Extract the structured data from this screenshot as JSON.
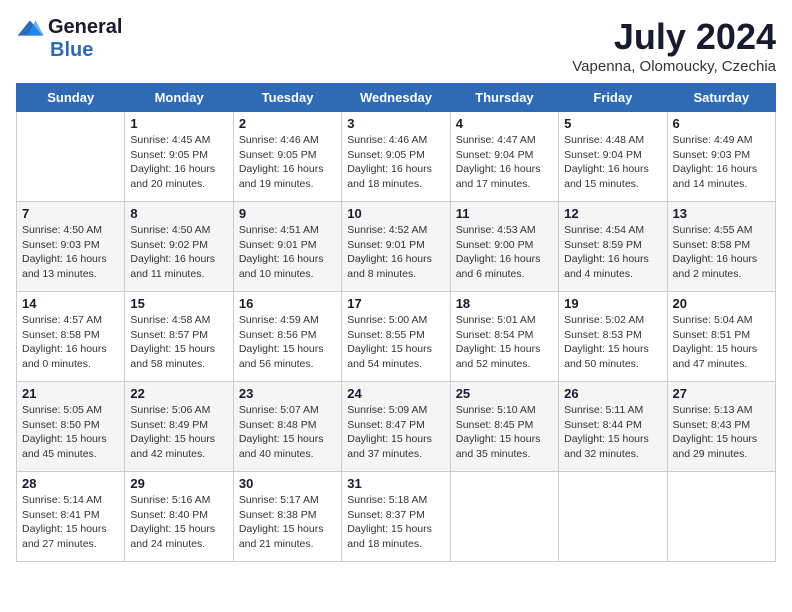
{
  "logo": {
    "general": "General",
    "blue": "Blue"
  },
  "title": "July 2024",
  "location": "Vapenna, Olomoucky, Czechia",
  "header": {
    "days": [
      "Sunday",
      "Monday",
      "Tuesday",
      "Wednesday",
      "Thursday",
      "Friday",
      "Saturday"
    ]
  },
  "weeks": [
    [
      {
        "day": "",
        "content": ""
      },
      {
        "day": "1",
        "content": "Sunrise: 4:45 AM\nSunset: 9:05 PM\nDaylight: 16 hours\nand 20 minutes."
      },
      {
        "day": "2",
        "content": "Sunrise: 4:46 AM\nSunset: 9:05 PM\nDaylight: 16 hours\nand 19 minutes."
      },
      {
        "day": "3",
        "content": "Sunrise: 4:46 AM\nSunset: 9:05 PM\nDaylight: 16 hours\nand 18 minutes."
      },
      {
        "day": "4",
        "content": "Sunrise: 4:47 AM\nSunset: 9:04 PM\nDaylight: 16 hours\nand 17 minutes."
      },
      {
        "day": "5",
        "content": "Sunrise: 4:48 AM\nSunset: 9:04 PM\nDaylight: 16 hours\nand 15 minutes."
      },
      {
        "day": "6",
        "content": "Sunrise: 4:49 AM\nSunset: 9:03 PM\nDaylight: 16 hours\nand 14 minutes."
      }
    ],
    [
      {
        "day": "7",
        "content": "Sunrise: 4:50 AM\nSunset: 9:03 PM\nDaylight: 16 hours\nand 13 minutes."
      },
      {
        "day": "8",
        "content": "Sunrise: 4:50 AM\nSunset: 9:02 PM\nDaylight: 16 hours\nand 11 minutes."
      },
      {
        "day": "9",
        "content": "Sunrise: 4:51 AM\nSunset: 9:01 PM\nDaylight: 16 hours\nand 10 minutes."
      },
      {
        "day": "10",
        "content": "Sunrise: 4:52 AM\nSunset: 9:01 PM\nDaylight: 16 hours\nand 8 minutes."
      },
      {
        "day": "11",
        "content": "Sunrise: 4:53 AM\nSunset: 9:00 PM\nDaylight: 16 hours\nand 6 minutes."
      },
      {
        "day": "12",
        "content": "Sunrise: 4:54 AM\nSunset: 8:59 PM\nDaylight: 16 hours\nand 4 minutes."
      },
      {
        "day": "13",
        "content": "Sunrise: 4:55 AM\nSunset: 8:58 PM\nDaylight: 16 hours\nand 2 minutes."
      }
    ],
    [
      {
        "day": "14",
        "content": "Sunrise: 4:57 AM\nSunset: 8:58 PM\nDaylight: 16 hours\nand 0 minutes."
      },
      {
        "day": "15",
        "content": "Sunrise: 4:58 AM\nSunset: 8:57 PM\nDaylight: 15 hours\nand 58 minutes."
      },
      {
        "day": "16",
        "content": "Sunrise: 4:59 AM\nSunset: 8:56 PM\nDaylight: 15 hours\nand 56 minutes."
      },
      {
        "day": "17",
        "content": "Sunrise: 5:00 AM\nSunset: 8:55 PM\nDaylight: 15 hours\nand 54 minutes."
      },
      {
        "day": "18",
        "content": "Sunrise: 5:01 AM\nSunset: 8:54 PM\nDaylight: 15 hours\nand 52 minutes."
      },
      {
        "day": "19",
        "content": "Sunrise: 5:02 AM\nSunset: 8:53 PM\nDaylight: 15 hours\nand 50 minutes."
      },
      {
        "day": "20",
        "content": "Sunrise: 5:04 AM\nSunset: 8:51 PM\nDaylight: 15 hours\nand 47 minutes."
      }
    ],
    [
      {
        "day": "21",
        "content": "Sunrise: 5:05 AM\nSunset: 8:50 PM\nDaylight: 15 hours\nand 45 minutes."
      },
      {
        "day": "22",
        "content": "Sunrise: 5:06 AM\nSunset: 8:49 PM\nDaylight: 15 hours\nand 42 minutes."
      },
      {
        "day": "23",
        "content": "Sunrise: 5:07 AM\nSunset: 8:48 PM\nDaylight: 15 hours\nand 40 minutes."
      },
      {
        "day": "24",
        "content": "Sunrise: 5:09 AM\nSunset: 8:47 PM\nDaylight: 15 hours\nand 37 minutes."
      },
      {
        "day": "25",
        "content": "Sunrise: 5:10 AM\nSunset: 8:45 PM\nDaylight: 15 hours\nand 35 minutes."
      },
      {
        "day": "26",
        "content": "Sunrise: 5:11 AM\nSunset: 8:44 PM\nDaylight: 15 hours\nand 32 minutes."
      },
      {
        "day": "27",
        "content": "Sunrise: 5:13 AM\nSunset: 8:43 PM\nDaylight: 15 hours\nand 29 minutes."
      }
    ],
    [
      {
        "day": "28",
        "content": "Sunrise: 5:14 AM\nSunset: 8:41 PM\nDaylight: 15 hours\nand 27 minutes."
      },
      {
        "day": "29",
        "content": "Sunrise: 5:16 AM\nSunset: 8:40 PM\nDaylight: 15 hours\nand 24 minutes."
      },
      {
        "day": "30",
        "content": "Sunrise: 5:17 AM\nSunset: 8:38 PM\nDaylight: 15 hours\nand 21 minutes."
      },
      {
        "day": "31",
        "content": "Sunrise: 5:18 AM\nSunset: 8:37 PM\nDaylight: 15 hours\nand 18 minutes."
      },
      {
        "day": "",
        "content": ""
      },
      {
        "day": "",
        "content": ""
      },
      {
        "day": "",
        "content": ""
      }
    ]
  ]
}
